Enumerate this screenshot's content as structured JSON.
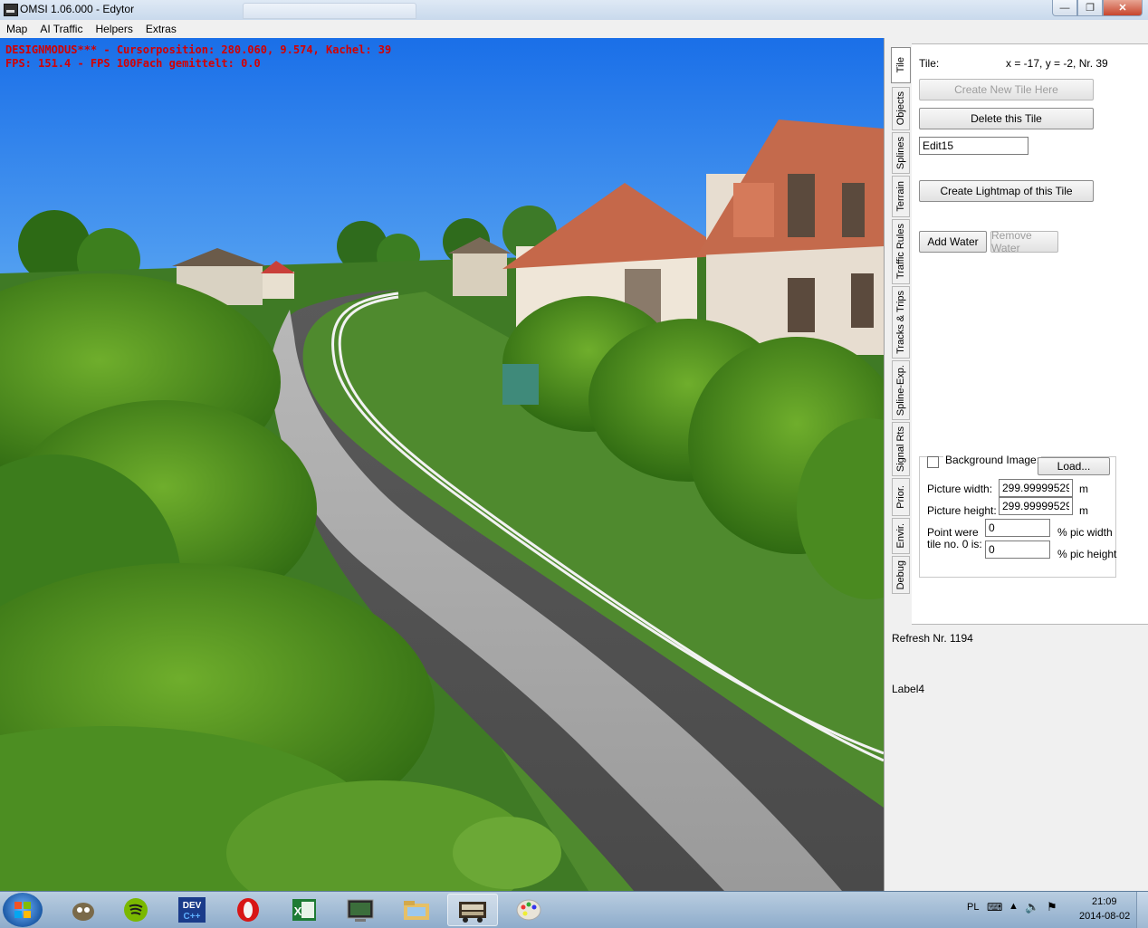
{
  "window": {
    "title": "OMSI 1.06.000 - Edytor"
  },
  "menu": [
    "Map",
    "AI Traffic",
    "Helpers",
    "Extras"
  ],
  "viewport": {
    "status_line1": "DESIGNMODUS*** - Cursorposition: 280.060, 9.574, Kachel: 39",
    "status_line2": "FPS: 151.4 - FPS 100Fach gemittelt: 0.0"
  },
  "tabs": [
    "Tile",
    "Objects",
    "Splines",
    "Terrain",
    "Traffic Rules",
    "Tracks & Trips",
    "Spline-Exp.",
    "Signal Rts",
    "Prior.",
    "Envir.",
    "Debug"
  ],
  "tile_panel": {
    "tile_label": "Tile:",
    "tile_info": "x = -17, y = -2, Nr. 39",
    "create_new_tile": "Create New Tile Here",
    "delete_tile": "Delete this Tile",
    "edit15_value": "Edit15",
    "create_lightmap": "Create Lightmap of this Tile",
    "add_water": "Add Water",
    "remove_water": "Remove Water",
    "background": {
      "checkbox_label": "Background Image:",
      "load_button": "Load...",
      "picture_width_label": "Picture width:",
      "picture_width_value": "299.999995292",
      "picture_height_label": "Picture height:",
      "picture_height_value": "299.999995292",
      "unit_m": "m",
      "point_label_1": "Point were",
      "point_label_2": "tile no. 0 is:",
      "point_x_value": "0",
      "point_y_value": "0",
      "pct_width": "% pic width",
      "pct_height": "% pic height"
    }
  },
  "refresh_label": "Refresh Nr. 1194",
  "label4": "Label4",
  "taskbar": {
    "apps": [
      "gimp-icon",
      "spotify-icon",
      "devcpp-icon",
      "opera-icon",
      "excel-icon",
      "terminal-icon",
      "explorer-icon",
      "omsi-icon",
      "paint-icon"
    ],
    "language": "PL",
    "time": "21:09",
    "date": "2014-08-02"
  }
}
